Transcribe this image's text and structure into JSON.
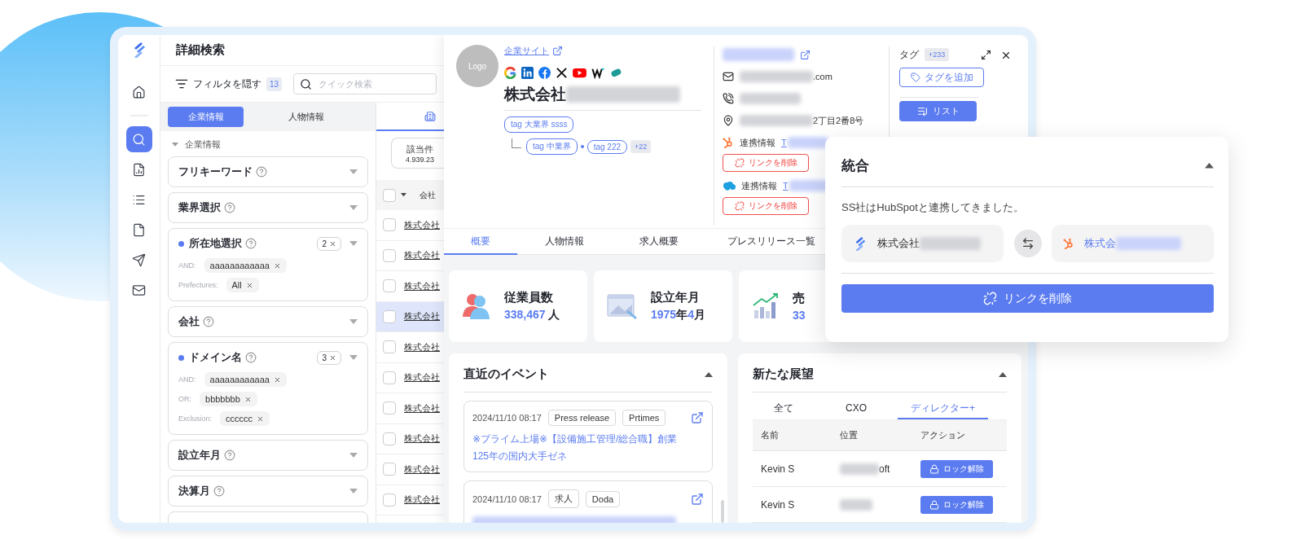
{
  "sidebar": {
    "groups": [
      [
        {
          "kind": "home",
          "selected": false
        }
      ],
      [
        {
          "kind": "search",
          "selected": true
        },
        {
          "kind": "report",
          "selected": false
        },
        {
          "kind": "list",
          "selected": false
        },
        {
          "kind": "file",
          "selected": false
        },
        {
          "kind": "send",
          "selected": false
        },
        {
          "kind": "mail",
          "selected": false
        }
      ]
    ]
  },
  "page": {
    "title": "詳細検索"
  },
  "toolbar": {
    "filter_button": "フィルタを隠す",
    "filter_count": "13",
    "search": {
      "placeholder": "クイック検索"
    }
  },
  "filter_tabs": [
    {
      "label": "企業情報",
      "selected": true
    },
    {
      "label": "人物情報",
      "selected": false
    }
  ],
  "filter_section": {
    "title": "企業情報",
    "expanded": true
  },
  "filters": [
    {
      "label": "フリキーワード",
      "active": false
    },
    {
      "label": "業界選択",
      "active": false
    },
    {
      "label": "所在地選択",
      "active": true,
      "count": "2",
      "conditions": [
        {
          "label": "AND:",
          "values": [
            "aaaaaaaaaaaa"
          ]
        },
        {
          "label": "Prefectures:",
          "values": [
            "All"
          ]
        }
      ]
    },
    {
      "label": "会社",
      "active": false
    },
    {
      "label": "ドメイン名",
      "active": true,
      "count": "3",
      "conditions": [
        {
          "label": "AND:",
          "values": [
            "aaaaaaaaaaaa"
          ]
        },
        {
          "label": "OR:",
          "values": [
            "bbbbbbb"
          ]
        },
        {
          "label": "Exclusion:",
          "values": [
            "cccccc"
          ]
        }
      ]
    },
    {
      "label": "設立年月",
      "active": false
    },
    {
      "label": "決算月",
      "active": false
    }
  ],
  "results": {
    "all_checked": false,
    "count_label": "該当件",
    "count_value": "4.939.23",
    "column": "会社",
    "rows": [
      {
        "name": "株式会社",
        "checked": false,
        "selected": false
      },
      {
        "name": "株式会社",
        "checked": false,
        "selected": false
      },
      {
        "name": "株式会社",
        "checked": false,
        "selected": false
      },
      {
        "name": "株式会社",
        "checked": false,
        "selected": true
      },
      {
        "name": "株式会社",
        "checked": false,
        "selected": false
      },
      {
        "name": "株式会社",
        "checked": false,
        "selected": false
      },
      {
        "name": "株式会社",
        "checked": false,
        "selected": false
      },
      {
        "name": "株式会社",
        "checked": false,
        "selected": false
      },
      {
        "name": "株式会社",
        "checked": false,
        "selected": false
      },
      {
        "name": "株式会社",
        "checked": false,
        "selected": false
      }
    ]
  },
  "company": {
    "logo": "Logo",
    "site_link": "企業サイト",
    "name": "株式会社",
    "tags": [
      "tag 大業界 ssss"
    ],
    "sub_tags": [
      "tag 中業界",
      "tag 222"
    ],
    "more_tags": "+22"
  },
  "contacts": {
    "email_suffix": ".com",
    "address_suffix": "2丁目2番8号",
    "integrations": [
      {
        "kind": "hubspot",
        "label": "連携情報",
        "value": "T",
        "action": "リンクを削除"
      },
      {
        "kind": "salesforce",
        "label": "連携情報",
        "value": "T",
        "action": "リンクを削除"
      }
    ]
  },
  "tag_panel": {
    "title": "タグ",
    "count": "+233",
    "add_button": "タグを追加",
    "list_button": "リスト"
  },
  "detail_tabs": [
    {
      "label": "概要",
      "selected": true
    },
    {
      "label": "人物情報",
      "selected": false
    },
    {
      "label": "求人概要",
      "selected": false
    },
    {
      "label": "プレスリリース一覧",
      "selected": false
    }
  ],
  "stats": [
    {
      "kind": "employees",
      "title": "従業員数",
      "value": [
        {
          "text": "338,467",
          "highlight": true
        },
        {
          "text": " 人",
          "highlight": false
        }
      ]
    },
    {
      "kind": "founded",
      "title": "設立年月",
      "value": [
        {
          "text": "1975",
          "highlight": true
        },
        {
          "text": "年",
          "highlight": false
        },
        {
          "text": "4",
          "highlight": true
        },
        {
          "text": "月",
          "highlight": false
        }
      ]
    },
    {
      "kind": "revenue",
      "title": "売",
      "value": [
        {
          "text": "33",
          "highlight": true
        }
      ]
    }
  ],
  "events": {
    "title": "直近のイベント",
    "expanded": true,
    "items": [
      {
        "date": "2024/11/10 08:17",
        "tags": [
          "Press release",
          "Prtimes"
        ],
        "title": "※プライム上場※【設備施工管理/総合職】創業125年の国内大手ゼネ"
      },
      {
        "date": "2024/11/10 08:17",
        "tags": [
          "求人",
          "Doda"
        ]
      }
    ]
  },
  "prospects": {
    "title": "新たな展望",
    "expanded": true,
    "tabs": [
      {
        "label": "全て",
        "selected": false
      },
      {
        "label": "CXO",
        "selected": false
      },
      {
        "label": "ディレクター+",
        "selected": true
      }
    ],
    "columns": [
      "名前",
      "位置",
      "アクション"
    ],
    "rows": [
      {
        "name": "Kevin S",
        "position": "oft",
        "action": "ロック解除"
      },
      {
        "name": "Kevin S",
        "action": "ロック解除"
      }
    ]
  },
  "popup": {
    "title": "統合",
    "expanded": true,
    "message": "SS社はHubSpotと連携してきました。",
    "left": {
      "kind": "app",
      "name": "株式会社"
    },
    "right": {
      "kind": "hubspot",
      "name": "株式会"
    },
    "button": "リンクを削除"
  }
}
